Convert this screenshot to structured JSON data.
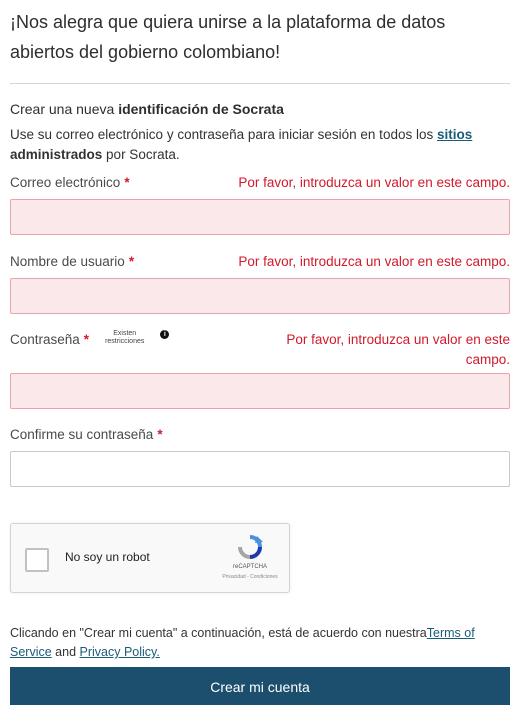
{
  "intro": {
    "line1": "¡Nos alegra que quiera unirse a la plataforma de datos",
    "line2": "abiertos del gobierno colombiano!"
  },
  "signup": {
    "heading_prefix": "Crear una nueva",
    "heading_bold": "identificación de Socrata",
    "desc_part1": "Use su correo electrónico y contraseña para iniciar sesión en todos los",
    "desc_link": "sitios",
    "desc_bold": "administrados",
    "desc_part2": "por Socrata."
  },
  "fields": {
    "email": {
      "label": "Correo electrónico",
      "required": "*",
      "error": "Por favor, introduzca un valor en este campo.",
      "value": ""
    },
    "username": {
      "label": "Nombre de usuario",
      "required": "*",
      "error": "Por favor, introduzca un valor en este campo.",
      "value": ""
    },
    "password": {
      "label": "Contraseña",
      "required": "*",
      "restrictions_line1": "Existen",
      "restrictions_line2": "restricciones",
      "info": "i",
      "error_line1": "Por favor, introduzca un valor en este",
      "error_line2": "campo.",
      "value": ""
    },
    "confirm": {
      "label": "Confirme su contraseña",
      "required": "*",
      "value": ""
    }
  },
  "captcha": {
    "label": "No soy un robot",
    "brand": "reCAPTCHA",
    "terms": "Privacidad - Condiciones",
    "checked": false
  },
  "legal": {
    "text": "Clicando en \"Crear mi cuenta\" a continuación, está de acuerdo con nuestra",
    "terms_link": "Terms of Service",
    "and": "and",
    "privacy_link": "Privacy Policy."
  },
  "submit": {
    "label": "Crear mi cuenta"
  },
  "colors": {
    "error": "#d11a2a",
    "button": "#1c4f6e",
    "link": "#1a5c78",
    "invalid_bg": "#fbe8ea"
  }
}
